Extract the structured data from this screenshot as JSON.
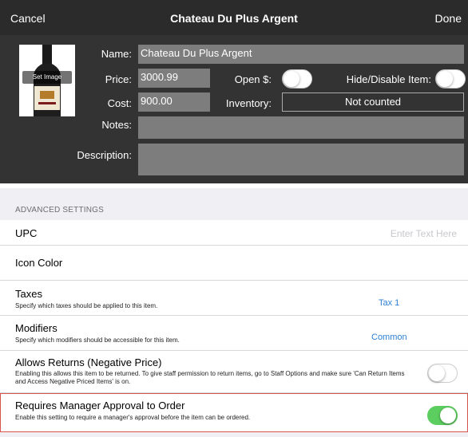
{
  "nav": {
    "cancel": "Cancel",
    "title": "Chateau Du Plus Argent",
    "done": "Done"
  },
  "header": {
    "set_image": "Set Image",
    "name_label": "Name:",
    "name_value": "Chateau Du Plus Argent",
    "price_label": "Price:",
    "price_value": "3000.99",
    "open_label": "Open $:",
    "open_on": false,
    "hide_label": "Hide/Disable Item:",
    "hide_on": false,
    "cost_label": "Cost:",
    "cost_value": "900.00",
    "inventory_label": "Inventory:",
    "inventory_value": "Not counted",
    "notes_label": "Notes:",
    "notes_value": "",
    "description_label": "Description:",
    "description_value": ""
  },
  "advanced": {
    "section_title": "ADVANCED SETTINGS",
    "upc_label": "UPC",
    "upc_placeholder": "Enter Text Here",
    "icon_color_label": "Icon Color",
    "taxes_label": "Taxes",
    "taxes_sub": "Specify which taxes should be applied to this item.",
    "taxes_value": "Tax 1",
    "modifiers_label": "Modifiers",
    "modifiers_sub": "Specify which modifiers should be accessible for this item.",
    "modifiers_value": "Common",
    "returns_label": "Allows Returns (Negative Price)",
    "returns_sub": "Enabling this allows this item to be returned. To give staff permission to return items, go to Staff Options and make sure 'Can Return Items and Access Negative Priced Items' is on.",
    "returns_on": false,
    "manager_label": "Requires Manager Approval to Order",
    "manager_sub": "Enable this setting to require a manager's approval before the item can be ordered.",
    "manager_on": true
  }
}
